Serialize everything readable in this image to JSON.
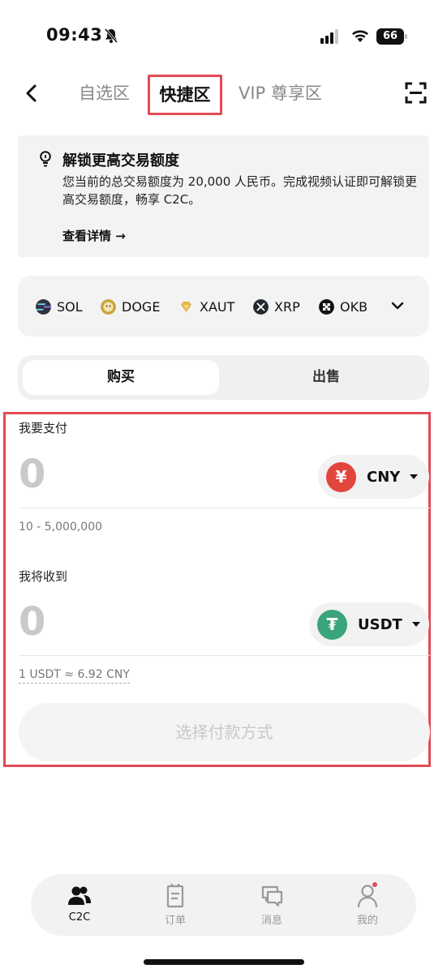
{
  "status": {
    "time": "09:43",
    "battery": "66"
  },
  "nav": {
    "tabs": [
      {
        "label": "自选区"
      },
      {
        "label": "快捷区"
      },
      {
        "label": "VIP 尊享区"
      }
    ]
  },
  "banner": {
    "title": "解锁更高交易额度",
    "description": "您当前的总交易额度为 20,000 人民币。完成视频认证即可解锁更高交易额度，畅享 C2C。",
    "link": "查看详情 →"
  },
  "coins": [
    {
      "symbol": "SOL",
      "color": "#2f3340"
    },
    {
      "symbol": "DOGE",
      "color": "#c9a43c"
    },
    {
      "symbol": "XAUT",
      "color": "#e8b54a"
    },
    {
      "symbol": "XRP",
      "color": "#23292f"
    },
    {
      "symbol": "OKB",
      "color": "#111111"
    }
  ],
  "trade_mode": {
    "buy": "购买",
    "sell": "出售",
    "selected": "购买"
  },
  "pay": {
    "label": "我要支付",
    "amount": "0",
    "currency": "CNY",
    "currency_symbol": "¥",
    "currency_color": "#e2453c",
    "range": "10 - 5,000,000"
  },
  "receive": {
    "label": "我将收到",
    "amount": "0",
    "currency": "USDT",
    "currency_symbol": "₮",
    "currency_color": "#3aa57a",
    "rate": "1 USDT ≈ 6.92 CNY"
  },
  "action": {
    "label": "选择付款方式"
  },
  "bottom_nav": [
    {
      "label": "C2C"
    },
    {
      "label": "订单"
    },
    {
      "label": "消息"
    },
    {
      "label": "我的"
    }
  ]
}
